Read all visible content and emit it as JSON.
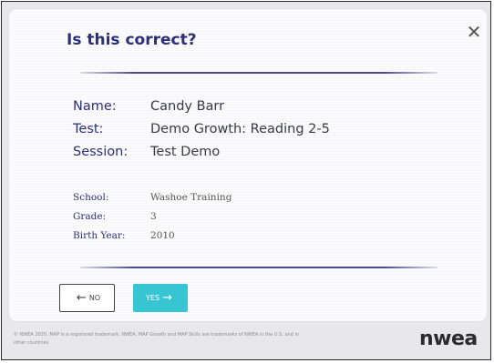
{
  "dialog": {
    "title": "Is this correct?",
    "close_icon": "close-icon",
    "close_glyph": "✕"
  },
  "student": {
    "primary": [
      {
        "label": "Name:",
        "value": "Candy Barr"
      },
      {
        "label": "Test:",
        "value": "Demo Growth: Reading 2-5"
      },
      {
        "label": "Session:",
        "value": "Test Demo"
      }
    ],
    "secondary": [
      {
        "label": "School:",
        "value": "Washoe Training"
      },
      {
        "label": "Grade:",
        "value": "3"
      },
      {
        "label": "Birth Year:",
        "value": "2010"
      }
    ]
  },
  "buttons": {
    "no_label": "NO",
    "no_arrow": "←",
    "yes_label": "YES",
    "yes_arrow": "→"
  },
  "footer": {
    "legal": "© NWEA 2020. MAP is a registered trademark, NWEA, MAP Growth and MAP Skills are trademarks of NWEA in the U.S. and in other countries.",
    "logo": "nwea"
  },
  "colors": {
    "title": "#2c2f7a",
    "yes_button": "#38c5d2",
    "rule": "#4a4a9a"
  }
}
